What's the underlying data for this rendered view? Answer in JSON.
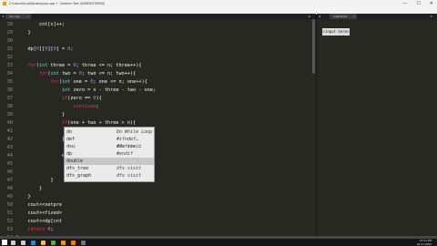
{
  "window": {
    "title": "C:\\Users\\Suraj\\Desktop\\cpc.cpp • - Sublime Text (UNREGISTERED)",
    "minimize_glyph": "—",
    "maximize_glyph": "☐",
    "close_glyph": "✕"
  },
  "menu": [
    "File",
    "Edit",
    "Selection",
    "Find",
    "View",
    "Goto",
    "Tools",
    "Project",
    "Preferences",
    "Help"
  ],
  "tabs": {
    "left": {
      "label": "cpc.cpp",
      "close_glyph": "×"
    },
    "right": {
      "label": "output.txt",
      "close_glyph": "×"
    },
    "prev_glyph": "◂",
    "next_glyph": "▸"
  },
  "code_lines": [
    {
      "n": "28",
      "html": "<span class='pl'>        cnt[x]++;</span>"
    },
    {
      "n": "29",
      "html": "<span class='pl'>    }</span>"
    },
    {
      "n": "30",
      "html": ""
    },
    {
      "n": "31",
      "html": "<span class='pl'>    dp[</span><span class='num'>0</span><span class='pl'>][</span><span class='num'>0</span><span class='pl'>][</span><span class='num'>0</span><span class='pl'>] = </span><span class='num'>0</span><span class='pl'>;</span>"
    },
    {
      "n": "32",
      "html": ""
    },
    {
      "n": "33",
      "html": "<span class='ctrl'>    for</span><span class='pl'>(</span><span class='kw'>int</span><span class='pl'> three = </span><span class='num'>0</span><span class='pl'>; three &lt;= n; three++){</span>"
    },
    {
      "n": "34",
      "html": "<span class='ctrl'>        for</span><span class='pl'>(</span><span class='kw'>int</span><span class='pl'> two = </span><span class='num'>0</span><span class='pl'>; two &lt;= n; two++){</span>"
    },
    {
      "n": "35",
      "html": "<span class='ctrl'>            for</span><span class='pl'>(</span><span class='kw'>int</span><span class='pl'> one = </span><span class='num'>0</span><span class='pl'>; one &lt;= n; one++){</span>"
    },
    {
      "n": "36",
      "html": "<span class='kw'>                int</span><span class='pl'> zero = n - three - two - one;</span>"
    },
    {
      "n": "37",
      "html": "<span class='ctrl'>                if</span><span class='pl'>(zero == </span><span class='num'>0</span><span class='pl'>){</span>"
    },
    {
      "n": "38",
      "html": "<span class='ctrl'>                    continue</span><span class='pl'>;</span>"
    },
    {
      "n": "39",
      "html": "<span class='pl'>                }</span>"
    },
    {
      "n": "40",
      "html": "<span class='ctrl'>                if</span><span class='pl'>(one + two + three &gt; n){</span>"
    },
    {
      "n": "41",
      "html": "<span class='ctrl'>                    continue</span><span class='pl'>;</span>"
    },
    {
      "n": "42",
      "html": "<span class='pl'>                }</span>"
    },
    {
      "n": "43",
      "html": ""
    },
    {
      "n": "44",
      "html": "<span class='pl'>                d</span>"
    },
    {
      "n": "45",
      "html": ""
    },
    {
      "n": "46",
      "html": ""
    },
    {
      "n": "47",
      "html": "<span class='pl'>            }</span>"
    },
    {
      "n": "48",
      "html": "<span class='pl'>        }</span>"
    },
    {
      "n": "49",
      "html": "<span class='pl'>    }</span>"
    },
    {
      "n": "50",
      "html": "<span class='pl'>    cout&lt;&lt;setpre</span>"
    },
    {
      "n": "51",
      "html": "<span class='pl'>    cout&lt;&lt;fixed&lt;</span>"
    },
    {
      "n": "52",
      "html": "<span class='pl'>    cout&lt;&lt;dp[cnt</span>"
    },
    {
      "n": "53",
      "html": "<span class='ctrl'>    return </span><span class='num'>0</span><span class='pl'>;</span>"
    },
    {
      "n": "54",
      "html": "<span class='pl'>}</span>"
    }
  ],
  "autocomplete": [
    {
      "key": "do",
      "desc": "Do While Loop"
    },
    {
      "key": "def",
      "desc": "#ifndef… #define … #endif"
    },
    {
      "key": "dsu",
      "desc": "dfs visit"
    },
    {
      "key": "dp",
      "desc": ""
    },
    {
      "key": "double",
      "desc": ""
    },
    {
      "key": "dfs_tree",
      "desc": "dfs visit"
    },
    {
      "key": "dfs_graph",
      "desc": "dfs visit"
    }
  ],
  "output_panel": {
    "input_text": "<input here>"
  },
  "taskbar": {
    "time": "07:21 PM",
    "date": "26-07-2020",
    "icons": [
      {
        "name": "search-icon",
        "color": "#cfcfcf"
      },
      {
        "name": "task-view-icon",
        "color": "#cfcfcf"
      },
      {
        "name": "edge-icon",
        "color": "#2b8ad8"
      },
      {
        "name": "explorer-icon",
        "color": "#f0c040"
      },
      {
        "name": "chrome-icon",
        "color": "#4caf50"
      },
      {
        "name": "sublime-icon",
        "color": "#ff9800"
      },
      {
        "name": "vlc-icon",
        "color": "#f57c00"
      },
      {
        "name": "terminal-icon",
        "color": "#777777"
      }
    ]
  },
  "colors": {
    "editor_bg": "#272822",
    "keyword": "#66d9ef",
    "control": "#f92672",
    "number": "#ae81ff"
  }
}
